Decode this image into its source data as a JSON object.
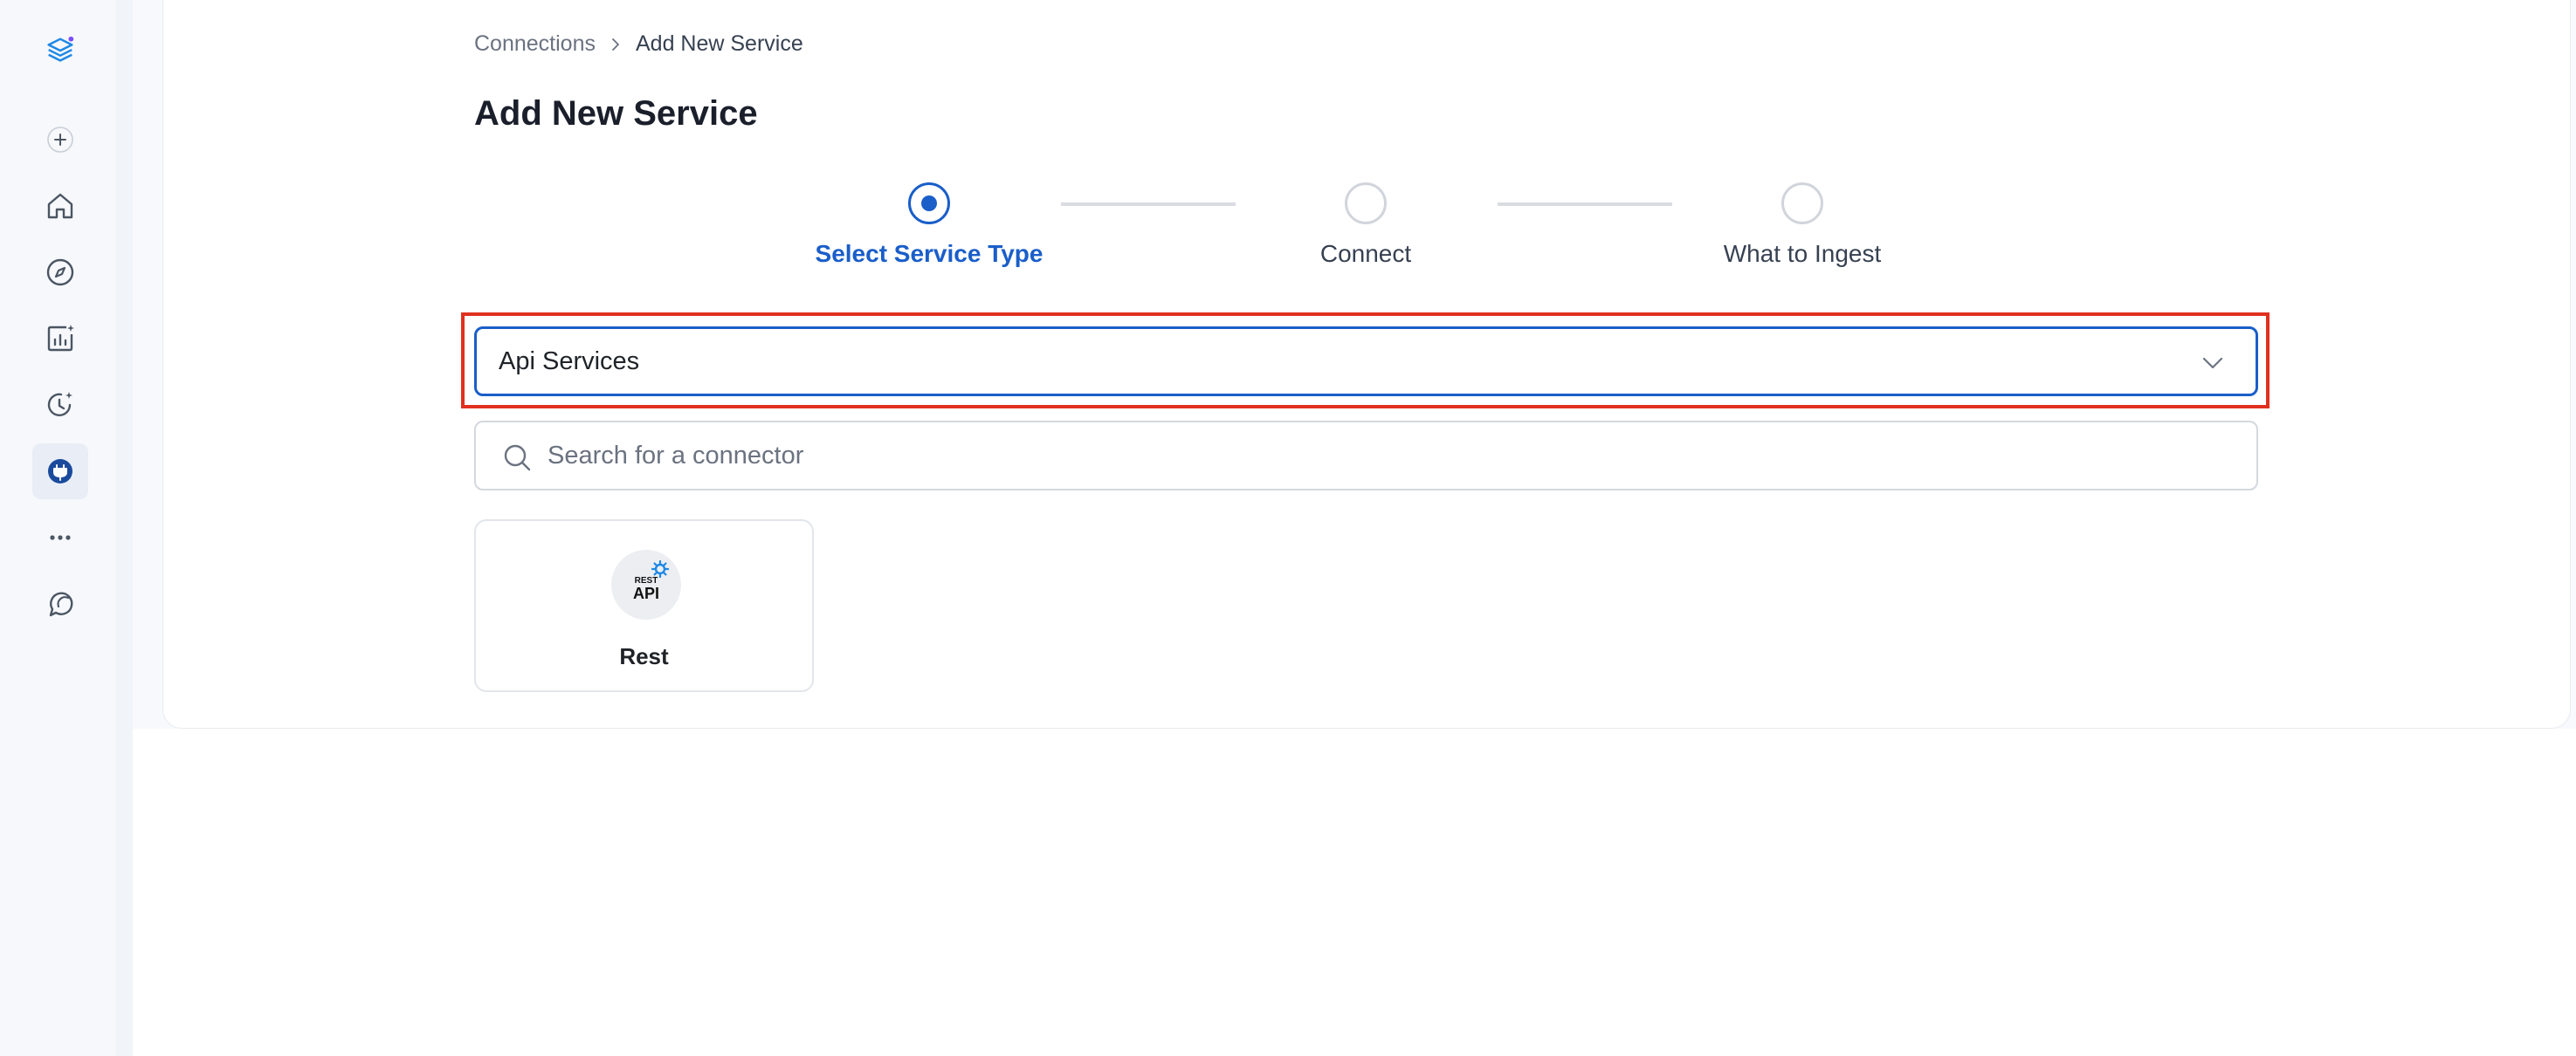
{
  "colors": {
    "accent": "#1a5ec9",
    "highlight": "#e0301e",
    "step_inactive": "#d1d5db",
    "brand_logo": "#1e88e5"
  },
  "sidebar": {
    "items": [
      {
        "icon": "layers-logo-icon"
      },
      {
        "icon": "plus-icon"
      },
      {
        "icon": "home-icon"
      },
      {
        "icon": "compass-icon"
      },
      {
        "icon": "chart-sparkle-icon"
      },
      {
        "icon": "clock-sparkle-icon"
      },
      {
        "icon": "plug-icon",
        "active": true
      },
      {
        "icon": "more-dots-icon"
      },
      {
        "icon": "chat-bubble-icon"
      }
    ]
  },
  "breadcrumb": {
    "parent": "Connections",
    "current": "Add New Service"
  },
  "page": {
    "title": "Add New Service"
  },
  "stepper": {
    "steps": [
      {
        "label": "Select Service Type",
        "active": true
      },
      {
        "label": "Connect",
        "active": false
      },
      {
        "label": "What to Ingest",
        "active": false
      }
    ]
  },
  "service_type_select": {
    "value": "Api Services"
  },
  "search": {
    "placeholder": "Search for a connector",
    "value": ""
  },
  "connectors": [
    {
      "name": "Rest",
      "logo_text_small": "REST",
      "logo_text_big": "API"
    }
  ]
}
